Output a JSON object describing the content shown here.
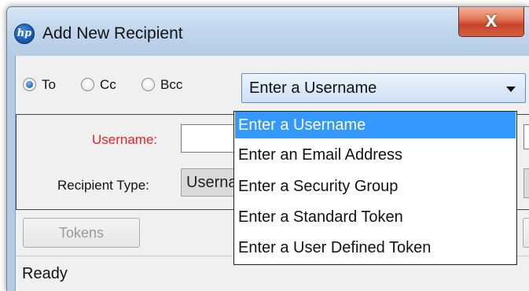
{
  "window": {
    "title": "Add New Recipient",
    "app_icon_glyph": "hp",
    "close_glyph": "X"
  },
  "radios": [
    {
      "label": "To",
      "checked": true
    },
    {
      "label": "Cc",
      "checked": false
    },
    {
      "label": "Bcc",
      "checked": false
    }
  ],
  "combo": {
    "value": "Enter a Username",
    "options": [
      "Enter a Username",
      "Enter an Email Address",
      "Enter a Security Group",
      "Enter a Standard Token",
      "Enter a User Defined Token"
    ],
    "selected_index": 0
  },
  "form": {
    "username_label": "Username:",
    "username_value": "",
    "recipient_type_label": "Recipient Type:",
    "recipient_type_value": "Userna"
  },
  "buttons": {
    "tokens_label": "Tokens"
  },
  "status": {
    "text": "Ready"
  },
  "colors": {
    "required_label": "#e8202a",
    "selection": "#3399ff",
    "close_button": "#c8432a"
  }
}
